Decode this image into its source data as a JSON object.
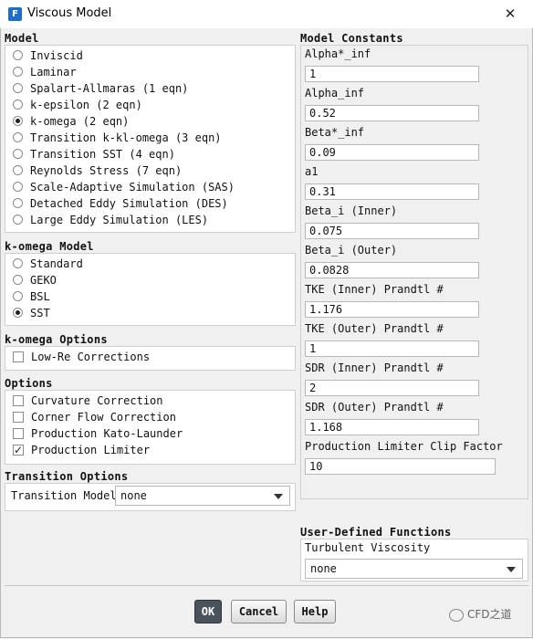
{
  "window": {
    "title": "Viscous Model",
    "icon_letter": "F",
    "close_symbol": "✕"
  },
  "model": {
    "title": "Model",
    "options": [
      {
        "label": "Inviscid",
        "selected": false
      },
      {
        "label": "Laminar",
        "selected": false
      },
      {
        "label": "Spalart-Allmaras (1 eqn)",
        "selected": false
      },
      {
        "label": "k-epsilon (2 eqn)",
        "selected": false
      },
      {
        "label": "k-omega (2 eqn)",
        "selected": true
      },
      {
        "label": "Transition k-kl-omega (3 eqn)",
        "selected": false
      },
      {
        "label": "Transition SST (4 eqn)",
        "selected": false
      },
      {
        "label": "Reynolds Stress (7 eqn)",
        "selected": false
      },
      {
        "label": "Scale-Adaptive Simulation (SAS)",
        "selected": false
      },
      {
        "label": "Detached Eddy Simulation (DES)",
        "selected": false
      },
      {
        "label": "Large Eddy Simulation (LES)",
        "selected": false
      }
    ]
  },
  "komega_model": {
    "title": "k-omega Model",
    "options": [
      {
        "label": "Standard",
        "selected": false
      },
      {
        "label": "GEKO",
        "selected": false
      },
      {
        "label": "BSL",
        "selected": false
      },
      {
        "label": "SST",
        "selected": true
      }
    ]
  },
  "komega_options": {
    "title": "k-omega Options",
    "items": [
      {
        "label": "Low-Re Corrections",
        "checked": false
      }
    ]
  },
  "options": {
    "title": "Options",
    "items": [
      {
        "label": "Curvature Correction",
        "checked": false
      },
      {
        "label": "Corner Flow Correction",
        "checked": false
      },
      {
        "label": "Production Kato-Launder",
        "checked": false
      },
      {
        "label": "Production Limiter",
        "checked": true
      }
    ]
  },
  "transition_options": {
    "title": "Transition Options",
    "label": "Transition Model",
    "value": "none"
  },
  "model_constants": {
    "title": "Model Constants",
    "items": [
      {
        "label": "Alpha*_inf",
        "value": "1"
      },
      {
        "label": "Alpha_inf",
        "value": "0.52"
      },
      {
        "label": "Beta*_inf",
        "value": "0.09"
      },
      {
        "label": "a1",
        "value": "0.31"
      },
      {
        "label": "Beta_i (Inner)",
        "value": "0.075"
      },
      {
        "label": "Beta_i (Outer)",
        "value": "0.0828"
      },
      {
        "label": "TKE (Inner) Prandtl #",
        "value": "1.176"
      },
      {
        "label": "TKE (Outer) Prandtl #",
        "value": "1"
      },
      {
        "label": "SDR (Inner) Prandtl #",
        "value": "2"
      },
      {
        "label": "SDR (Outer) Prandtl #",
        "value": "1.168"
      },
      {
        "label": "Production Limiter Clip Factor",
        "value": "10"
      }
    ]
  },
  "udf": {
    "title": "User-Defined Functions",
    "label": "Turbulent Viscosity",
    "value": "none"
  },
  "buttons": {
    "ok": "OK",
    "cancel": "Cancel",
    "help": "Help"
  },
  "watermark": "CFD之道",
  "colors": {
    "accent": "#1e6ec8",
    "primary_button": "#4a525c"
  }
}
